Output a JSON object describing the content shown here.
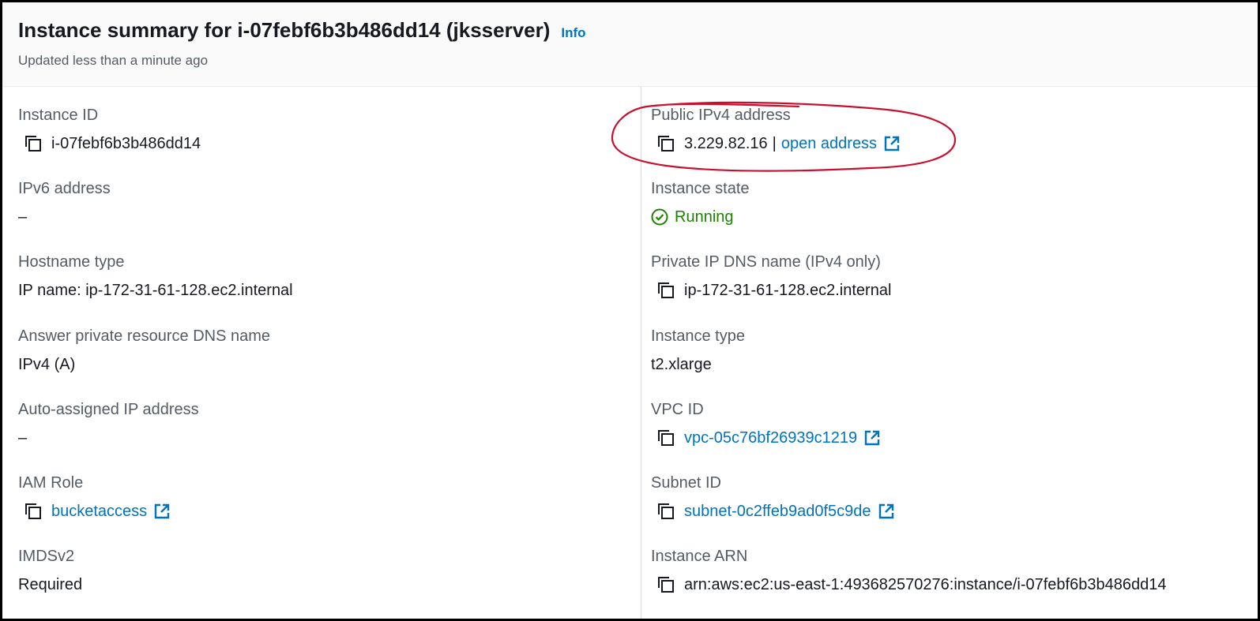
{
  "header": {
    "title": "Instance summary for i-07febf6b3b486dd14 (jksserver)",
    "info_label": "Info",
    "updated": "Updated less than a minute ago"
  },
  "left": {
    "instance_id": {
      "label": "Instance ID",
      "value": "i-07febf6b3b486dd14"
    },
    "ipv6": {
      "label": "IPv6 address",
      "value": "–"
    },
    "hostname_type": {
      "label": "Hostname type",
      "value": "IP name: ip-172-31-61-128.ec2.internal"
    },
    "answer_dns": {
      "label": "Answer private resource DNS name",
      "value": "IPv4 (A)"
    },
    "auto_ip": {
      "label": "Auto-assigned IP address",
      "value": "–"
    },
    "iam_role": {
      "label": "IAM Role",
      "value": "bucketaccess"
    },
    "imdsv2": {
      "label": "IMDSv2",
      "value": "Required"
    }
  },
  "right": {
    "public_ipv4": {
      "label": "Public IPv4 address",
      "value": "3.229.82.16",
      "separator": "|",
      "link": "open address"
    },
    "instance_state": {
      "label": "Instance state",
      "value": "Running"
    },
    "private_dns": {
      "label": "Private IP DNS name (IPv4 only)",
      "value": "ip-172-31-61-128.ec2.internal"
    },
    "instance_type": {
      "label": "Instance type",
      "value": "t2.xlarge"
    },
    "vpc_id": {
      "label": "VPC ID",
      "value": "vpc-05c76bf26939c1219"
    },
    "subnet_id": {
      "label": "Subnet ID",
      "value": "subnet-0c2ffeb9ad0f5c9de"
    },
    "instance_arn": {
      "label": "Instance ARN",
      "value": "arn:aws:ec2:us-east-1:493682570276:instance/i-07febf6b3b486dd14"
    }
  },
  "icons": {
    "copy": "copy-icon",
    "external": "external-link-icon",
    "status": "check-circle-icon"
  },
  "colors": {
    "link": "#0073bb",
    "running": "#1d8102",
    "annotation": "#c8102e"
  }
}
